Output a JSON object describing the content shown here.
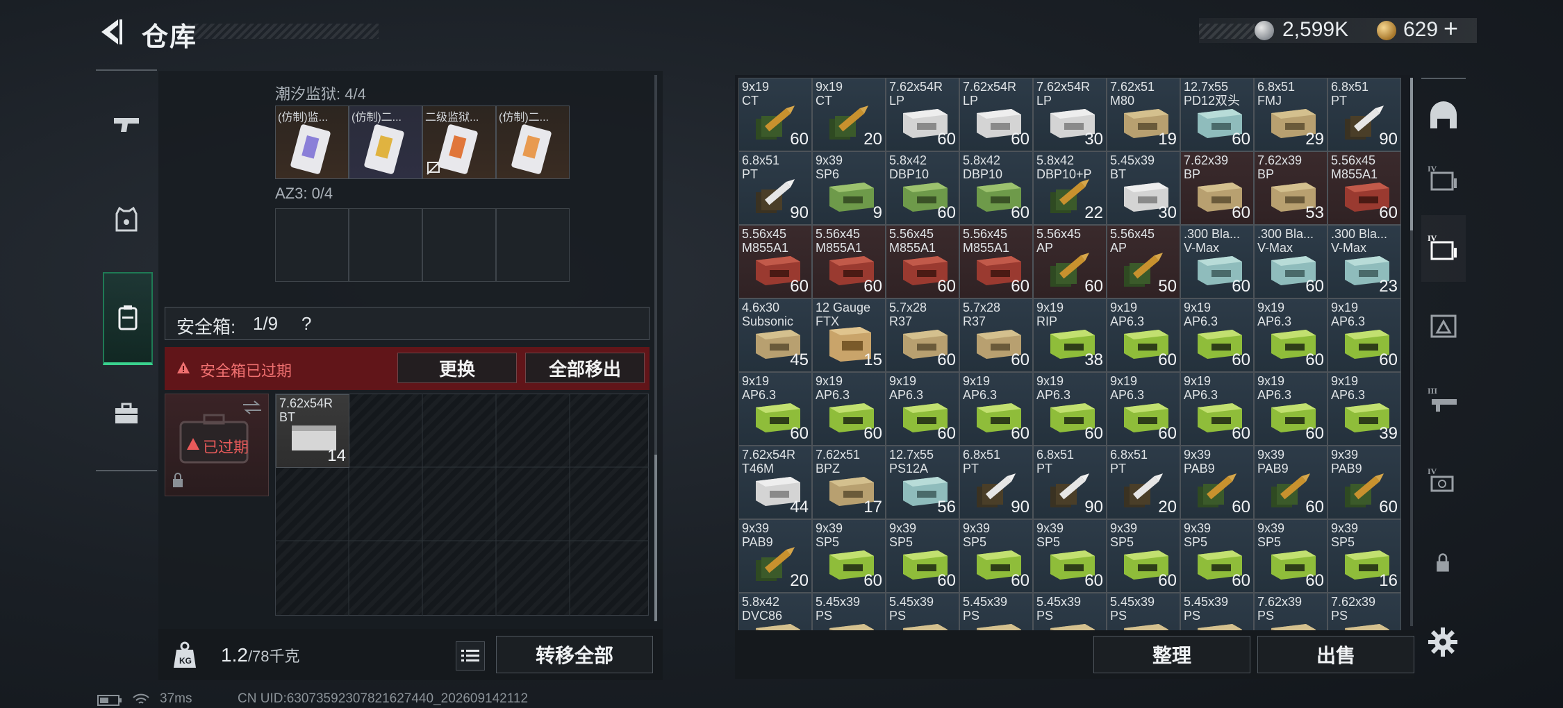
{
  "header": {
    "title": "仓库",
    "silver_amount": "2,599K",
    "gold_amount": "629",
    "add_symbol": "+"
  },
  "left_nav": [
    "weapon-tab",
    "armor-tab",
    "backpack-tab",
    "case-tab"
  ],
  "containers": {
    "tide_prison": {
      "label": "潮汐监狱: 4/4",
      "cards": [
        {
          "label": "(仿制)监..."
        },
        {
          "label": "(仿制)二..."
        },
        {
          "label": "二级监狱..."
        },
        {
          "label": "(仿制)二..."
        }
      ]
    },
    "az3": {
      "label": "AZ3: 0/4"
    }
  },
  "safe_box": {
    "label": "安全箱:",
    "count": "1/9",
    "help": "?",
    "warning": "安全箱已过期",
    "replace_label": "更换",
    "move_all_label": "全部移出",
    "expired_label": "已过期",
    "item": {
      "name": "7.62x54R",
      "sub": "BT",
      "count": "14"
    }
  },
  "footer_left": {
    "weight_current": "1.2",
    "weight_max": "/78千克",
    "transfer_all_label": "转移全部"
  },
  "footer_right": {
    "sort_label": "整理",
    "sell_label": "出售"
  },
  "inventory": [
    {
      "name": "9x19",
      "sub": "CT",
      "count": "60",
      "art": "bullet",
      "tone": "blue"
    },
    {
      "name": "9x19",
      "sub": "CT",
      "count": "20",
      "art": "bullet",
      "tone": "blue"
    },
    {
      "name": "7.62x54R",
      "sub": "LP",
      "count": "60",
      "art": "box-white",
      "tone": "blue"
    },
    {
      "name": "7.62x54R",
      "sub": "LP",
      "count": "60",
      "art": "box-white",
      "tone": "blue"
    },
    {
      "name": "7.62x54R",
      "sub": "LP",
      "count": "30",
      "art": "box-white",
      "tone": "blue"
    },
    {
      "name": "7.62x51",
      "sub": "M80",
      "count": "19",
      "art": "box-tan",
      "tone": "blue"
    },
    {
      "name": "12.7x55",
      "sub": "PD12双头",
      "count": "60",
      "art": "box-teal",
      "tone": "blue"
    },
    {
      "name": "6.8x51",
      "sub": "FMJ",
      "count": "29",
      "art": "box-tan",
      "tone": "blue"
    },
    {
      "name": "6.8x51",
      "sub": "PT",
      "count": "90",
      "art": "bullet-white",
      "tone": "blue"
    },
    {
      "name": "6.8x51",
      "sub": "PT",
      "count": "90",
      "art": "bullet-white",
      "tone": "blue"
    },
    {
      "name": "9x39",
      "sub": "SP6",
      "count": "9",
      "art": "box-green",
      "tone": "blue"
    },
    {
      "name": "5.8x42",
      "sub": "DBP10",
      "count": "60",
      "art": "box-green",
      "tone": "blue"
    },
    {
      "name": "5.8x42",
      "sub": "DBP10",
      "count": "60",
      "art": "box-green",
      "tone": "blue"
    },
    {
      "name": "5.8x42",
      "sub": "DBP10+P",
      "count": "22",
      "art": "bullet",
      "tone": "blue"
    },
    {
      "name": "5.45x39",
      "sub": "BT",
      "count": "30",
      "art": "box-white",
      "tone": "blue"
    },
    {
      "name": "7.62x39",
      "sub": "BP",
      "count": "60",
      "art": "box-tan",
      "tone": "red"
    },
    {
      "name": "7.62x39",
      "sub": "BP",
      "count": "53",
      "art": "box-tan",
      "tone": "red"
    },
    {
      "name": "5.56x45",
      "sub": "M855A1",
      "count": "60",
      "art": "box-red",
      "tone": "red"
    },
    {
      "name": "5.56x45",
      "sub": "M855A1",
      "count": "60",
      "art": "box-red",
      "tone": "red"
    },
    {
      "name": "5.56x45",
      "sub": "M855A1",
      "count": "60",
      "art": "box-red",
      "tone": "red"
    },
    {
      "name": "5.56x45",
      "sub": "M855A1",
      "count": "60",
      "art": "box-red",
      "tone": "red"
    },
    {
      "name": "5.56x45",
      "sub": "M855A1",
      "count": "60",
      "art": "box-red",
      "tone": "red"
    },
    {
      "name": "5.56x45",
      "sub": "AP",
      "count": "60",
      "art": "bullet",
      "tone": "red"
    },
    {
      "name": "5.56x45",
      "sub": "AP",
      "count": "50",
      "art": "bullet",
      "tone": "red"
    },
    {
      "name": ".300 Bla...",
      "sub": "V-Max",
      "count": "60",
      "art": "box-teal",
      "tone": "blue"
    },
    {
      "name": ".300 Bla...",
      "sub": "V-Max",
      "count": "60",
      "art": "box-teal",
      "tone": "blue"
    },
    {
      "name": ".300 Bla...",
      "sub": "V-Max",
      "count": "23",
      "art": "box-teal",
      "tone": "blue"
    },
    {
      "name": "4.6x30",
      "sub": "Subsonic",
      "count": "45",
      "art": "box-tan",
      "tone": "blue"
    },
    {
      "name": "12 Gauge",
      "sub": "FTX",
      "count": "15",
      "art": "box-orange",
      "tone": "blue"
    },
    {
      "name": "5.7x28",
      "sub": "R37",
      "count": "60",
      "art": "box-tan",
      "tone": "blue"
    },
    {
      "name": "5.7x28",
      "sub": "R37",
      "count": "60",
      "art": "box-tan",
      "tone": "blue"
    },
    {
      "name": "9x19",
      "sub": "RIP",
      "count": "38",
      "art": "box-lime",
      "tone": "blue"
    },
    {
      "name": "9x19",
      "sub": "AP6.3",
      "count": "60",
      "art": "box-lime",
      "tone": "blue"
    },
    {
      "name": "9x19",
      "sub": "AP6.3",
      "count": "60",
      "art": "box-lime",
      "tone": "blue"
    },
    {
      "name": "9x19",
      "sub": "AP6.3",
      "count": "60",
      "art": "box-lime",
      "tone": "blue"
    },
    {
      "name": "9x19",
      "sub": "AP6.3",
      "count": "60",
      "art": "box-lime",
      "tone": "blue"
    },
    {
      "name": "9x19",
      "sub": "AP6.3",
      "count": "60",
      "art": "box-lime",
      "tone": "blue"
    },
    {
      "name": "9x19",
      "sub": "AP6.3",
      "count": "60",
      "art": "box-lime",
      "tone": "blue"
    },
    {
      "name": "9x19",
      "sub": "AP6.3",
      "count": "60",
      "art": "box-lime",
      "tone": "blue"
    },
    {
      "name": "9x19",
      "sub": "AP6.3",
      "count": "60",
      "art": "box-lime",
      "tone": "blue"
    },
    {
      "name": "9x19",
      "sub": "AP6.3",
      "count": "60",
      "art": "box-lime",
      "tone": "blue"
    },
    {
      "name": "9x19",
      "sub": "AP6.3",
      "count": "60",
      "art": "box-lime",
      "tone": "blue"
    },
    {
      "name": "9x19",
      "sub": "AP6.3",
      "count": "60",
      "art": "box-lime",
      "tone": "blue"
    },
    {
      "name": "9x19",
      "sub": "AP6.3",
      "count": "60",
      "art": "box-lime",
      "tone": "blue"
    },
    {
      "name": "9x19",
      "sub": "AP6.3",
      "count": "39",
      "art": "box-lime",
      "tone": "blue"
    },
    {
      "name": "7.62x54R",
      "sub": "T46M",
      "count": "44",
      "art": "box-white",
      "tone": "blue"
    },
    {
      "name": "7.62x51",
      "sub": "BPZ",
      "count": "17",
      "art": "box-tan",
      "tone": "blue"
    },
    {
      "name": "12.7x55",
      "sub": "PS12A",
      "count": "56",
      "art": "box-teal",
      "tone": "blue"
    },
    {
      "name": "6.8x51",
      "sub": "PT",
      "count": "90",
      "art": "bullet-white",
      "tone": "blue"
    },
    {
      "name": "6.8x51",
      "sub": "PT",
      "count": "90",
      "art": "bullet-white",
      "tone": "blue"
    },
    {
      "name": "6.8x51",
      "sub": "PT",
      "count": "20",
      "art": "bullet-white",
      "tone": "blue"
    },
    {
      "name": "9x39",
      "sub": "PAB9",
      "count": "60",
      "art": "bullet",
      "tone": "blue"
    },
    {
      "name": "9x39",
      "sub": "PAB9",
      "count": "60",
      "art": "bullet",
      "tone": "blue"
    },
    {
      "name": "9x39",
      "sub": "PAB9",
      "count": "60",
      "art": "bullet",
      "tone": "blue"
    },
    {
      "name": "9x39",
      "sub": "PAB9",
      "count": "20",
      "art": "bullet",
      "tone": "blue"
    },
    {
      "name": "9x39",
      "sub": "SP5",
      "count": "60",
      "art": "box-lime",
      "tone": "blue"
    },
    {
      "name": "9x39",
      "sub": "SP5",
      "count": "60",
      "art": "box-lime",
      "tone": "blue"
    },
    {
      "name": "9x39",
      "sub": "SP5",
      "count": "60",
      "art": "box-lime",
      "tone": "blue"
    },
    {
      "name": "9x39",
      "sub": "SP5",
      "count": "60",
      "art": "box-lime",
      "tone": "blue"
    },
    {
      "name": "9x39",
      "sub": "SP5",
      "count": "60",
      "art": "box-lime",
      "tone": "blue"
    },
    {
      "name": "9x39",
      "sub": "SP5",
      "count": "60",
      "art": "box-lime",
      "tone": "blue"
    },
    {
      "name": "9x39",
      "sub": "SP5",
      "count": "60",
      "art": "box-lime",
      "tone": "blue"
    },
    {
      "name": "9x39",
      "sub": "SP5",
      "count": "16",
      "art": "box-lime",
      "tone": "blue"
    },
    {
      "name": "5.8x42",
      "sub": "DVC86",
      "count": "",
      "art": "box-tan",
      "tone": "blue"
    },
    {
      "name": "5.45x39",
      "sub": "PS",
      "count": "",
      "art": "box-tan",
      "tone": "blue"
    },
    {
      "name": "5.45x39",
      "sub": "PS",
      "count": "",
      "art": "box-tan",
      "tone": "blue"
    },
    {
      "name": "5.45x39",
      "sub": "PS",
      "count": "",
      "art": "box-tan",
      "tone": "blue"
    },
    {
      "name": "5.45x39",
      "sub": "PS",
      "count": "",
      "art": "box-tan",
      "tone": "blue"
    },
    {
      "name": "5.45x39",
      "sub": "PS",
      "count": "",
      "art": "box-tan",
      "tone": "blue"
    },
    {
      "name": "5.45x39",
      "sub": "PS",
      "count": "",
      "art": "box-tan",
      "tone": "blue"
    },
    {
      "name": "7.62x39",
      "sub": "PS",
      "count": "",
      "art": "box-tan",
      "tone": "blue"
    },
    {
      "name": "7.62x39",
      "sub": "PS",
      "count": "",
      "art": "box-tan",
      "tone": "blue"
    }
  ],
  "right_tabs": [
    "helmet-tab",
    "container-iv-tab",
    "container-iv-b-tab",
    "rig-tab",
    "container-iii-tab",
    "container-iv-c-tab"
  ],
  "status_bar": {
    "ping": "37ms",
    "uid": "CN UID:63073592307821627440_202609142112"
  },
  "colors": {
    "warning_red": "#6e1418",
    "accent_green": "#3ad28e",
    "lime_box": "#9acd45",
    "tan_box": "#c9b27a"
  }
}
